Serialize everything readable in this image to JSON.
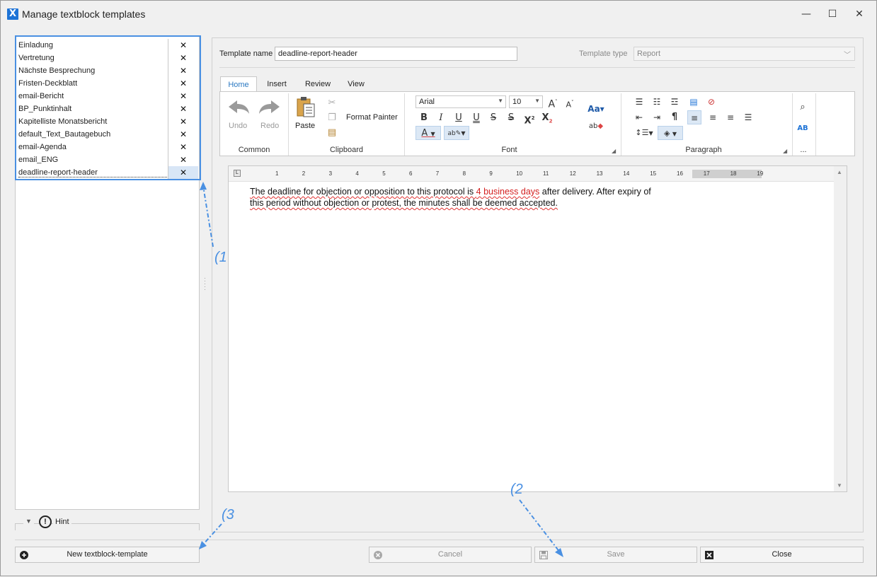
{
  "window": {
    "title": "Manage textblock templates",
    "app_icon_letter": "X",
    "controls": {
      "minimize": "—",
      "maximize": "☐",
      "close": "✕"
    }
  },
  "template_list": {
    "items": [
      "Einladung",
      "Vertretung",
      "Nächste Besprechung",
      "Fristen-Deckblatt",
      "email-Bericht",
      "BP_Punktinhalt",
      "Kapitelliste Monatsbericht",
      "default_Text_Bautagebuch",
      "email-Agenda",
      "email_ENG",
      "deadline-report-header"
    ],
    "delete_glyph": "✕",
    "selected_index": 10
  },
  "hint": {
    "label": "Hint",
    "icon_glyph": "!"
  },
  "form": {
    "template_name_label": "Template name",
    "template_name_value": "deadline-report-header",
    "template_type_label": "Template type",
    "template_type_value": "Report"
  },
  "ribbon": {
    "tabs": [
      "Home",
      "Insert",
      "Review",
      "View"
    ],
    "active_tab": "Home",
    "groups": {
      "common": {
        "label": "Common",
        "undo": "Undo",
        "redo": "Redo"
      },
      "clipboard": {
        "label": "Clipboard",
        "paste": "Paste",
        "format_painter": "Format Painter"
      },
      "font": {
        "label": "Font",
        "font_name": "Arial",
        "font_size": "10"
      },
      "paragraph": {
        "label": "Paragraph"
      },
      "more": {
        "label": "..."
      }
    }
  },
  "editor": {
    "ruler_numbers": [
      "1",
      "2",
      "3",
      "4",
      "5",
      "6",
      "7",
      "8",
      "9",
      "10",
      "11",
      "12",
      "13",
      "14",
      "15",
      "16",
      "17",
      "18",
      "19"
    ],
    "text_before": "The deadline for objection or opposition to this protocol is ",
    "text_highlight": "4 business days",
    "text_after_1": " after delivery. After expiry of",
    "text_line2": "this period without objection or protest, the minutes shall be deemed accepted."
  },
  "buttons": {
    "new_template": "New textblock-template",
    "cancel": "Cancel",
    "save": "Save",
    "close": "Close"
  },
  "annotations": {
    "one": "(1",
    "two": "(2",
    "three": "(3"
  },
  "colors": {
    "accent": "#2b79c2",
    "annotation": "#4a90e2",
    "highlight_text": "#d42020",
    "spellcheck": "#e03030"
  }
}
